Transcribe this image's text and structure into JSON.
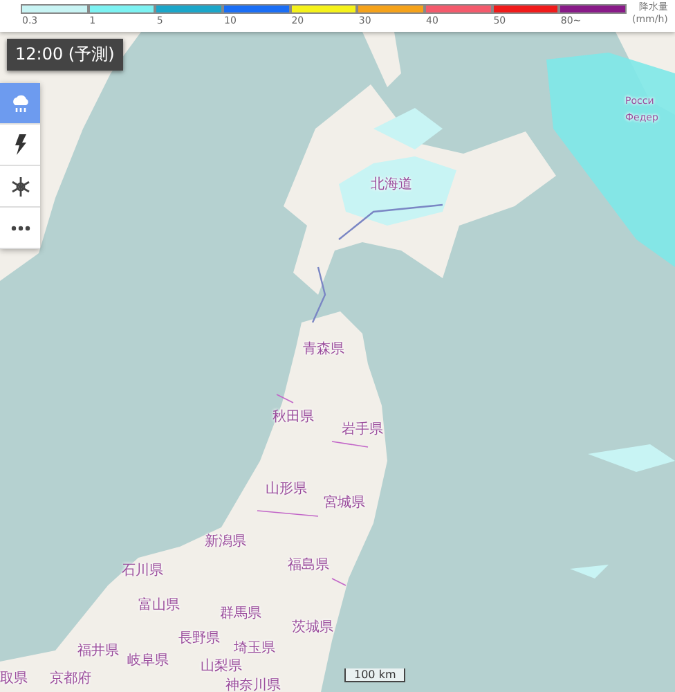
{
  "legend": {
    "title": "降水量",
    "unit": "(mm/h)",
    "bins": [
      {
        "label": "0.3",
        "color": "#c8f4f4"
      },
      {
        "label": "1",
        "color": "#7cf2f2"
      },
      {
        "label": "5",
        "color": "#1ba6c9"
      },
      {
        "label": "10",
        "color": "#1a6ef5"
      },
      {
        "label": "20",
        "color": "#f5f21a"
      },
      {
        "label": "30",
        "color": "#f5a21a"
      },
      {
        "label": "40",
        "color": "#f45a6c"
      },
      {
        "label": "50",
        "color": "#f01a1a"
      },
      {
        "label": "80~",
        "color": "#881a88"
      }
    ]
  },
  "time_badge": "12:00 (予測)",
  "layer_buttons": [
    {
      "kind": "rain",
      "selected": true
    },
    {
      "kind": "lightning",
      "selected": false
    },
    {
      "kind": "snow",
      "selected": false
    },
    {
      "kind": "more",
      "selected": false
    }
  ],
  "map_labels": [
    "Росси",
    "Федер",
    "北海道",
    "青森県",
    "秋田県",
    "岩手県",
    "山形県",
    "宮城県",
    "新潟県",
    "福島県",
    "石川県",
    "富山県",
    "群馬県",
    "茨城県",
    "長野県",
    "埼玉県",
    "福井県",
    "岐阜県",
    "山梨県",
    "取県",
    "京都府",
    "神奈川県"
  ],
  "scale": "100 km"
}
